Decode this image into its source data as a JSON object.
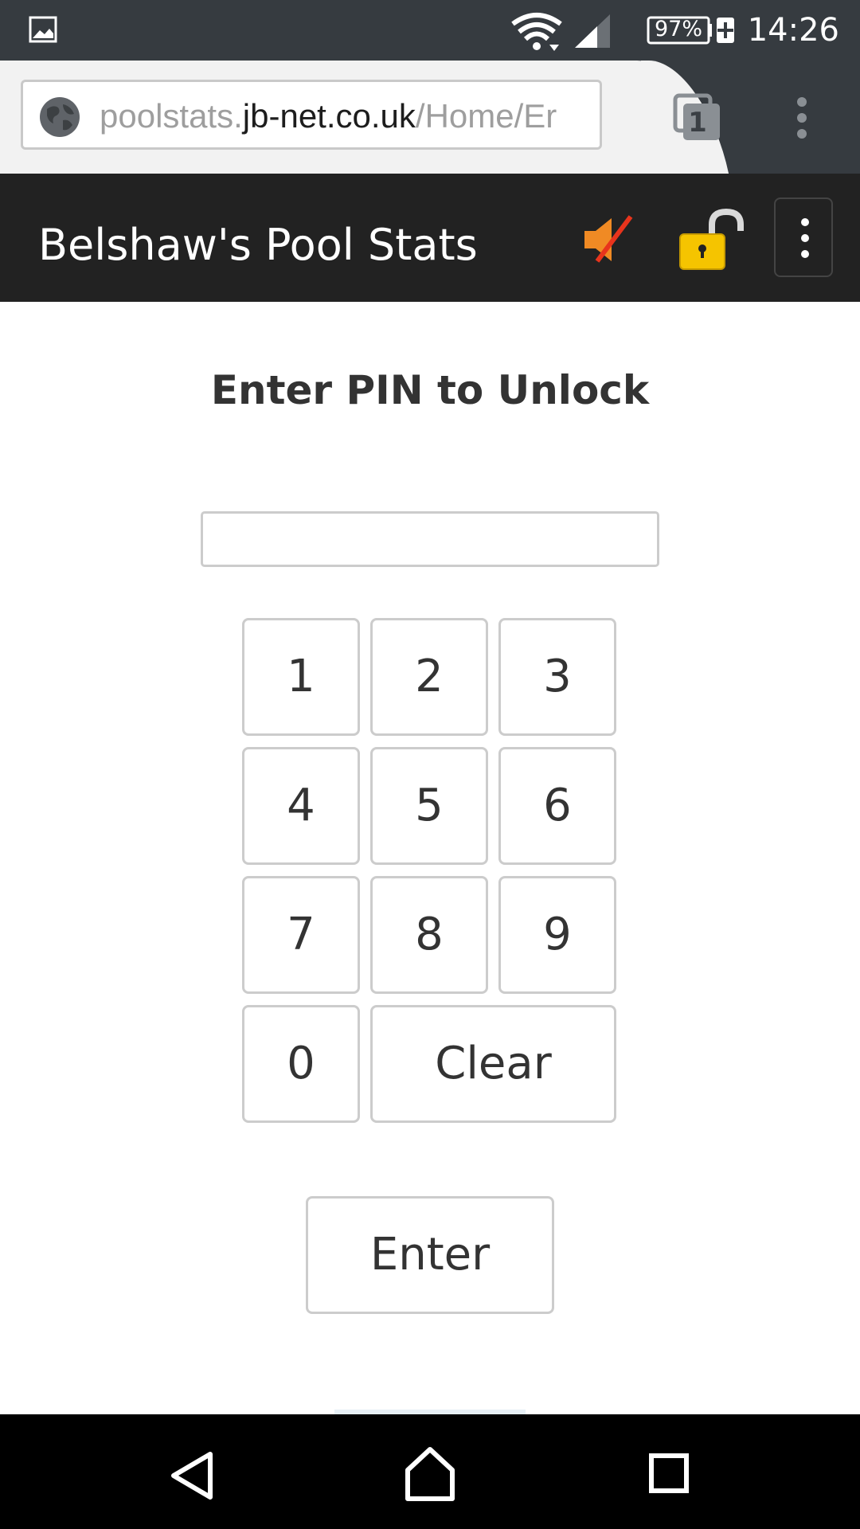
{
  "status_bar": {
    "battery": "97%",
    "time": "14:26"
  },
  "browser": {
    "url_prefix": "poolstats.",
    "url_host": "jb-net.co.uk",
    "url_path": "/Home/Er",
    "tab_count": "1"
  },
  "navbar": {
    "title": "Belshaw's Pool Stats",
    "icons": [
      "mute-icon",
      "unlock-icon",
      "menu-icon"
    ],
    "colors": {
      "background": "#222222",
      "mute_orange": "#f08a24",
      "lock_yellow": "#f5c400"
    }
  },
  "main": {
    "heading": "Enter PIN to Unlock",
    "pin_value": "",
    "keys": {
      "k1": "1",
      "k2": "2",
      "k3": "3",
      "k4": "4",
      "k5": "5",
      "k6": "6",
      "k7": "7",
      "k8": "8",
      "k9": "9",
      "k0": "0",
      "clear": "Clear"
    },
    "enter_label": "Enter"
  },
  "system_nav": {
    "icons": [
      "back-icon",
      "home-icon",
      "recents-icon"
    ]
  }
}
